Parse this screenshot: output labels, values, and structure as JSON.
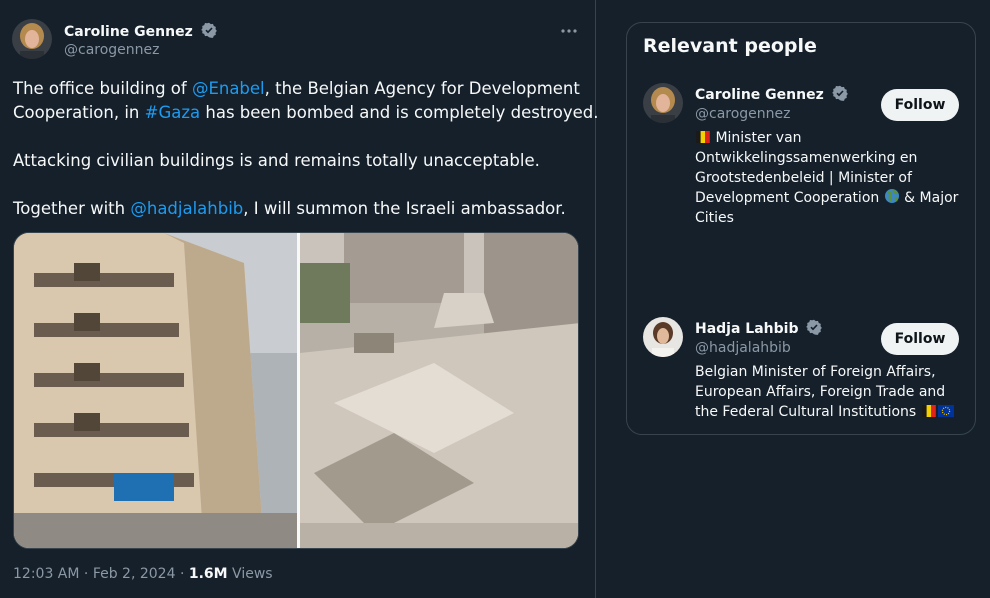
{
  "tweet": {
    "author_name": "Caroline Gennez",
    "author_handle": "@carogennez",
    "more_label": "···",
    "paragraph1": {
      "t1": "The office building of ",
      "mention1": "@Enabel",
      "t2": ", the Belgian Agency for Development",
      "t3": "Cooperation, in ",
      "hashtag": "#Gaza",
      "t4": " has been bombed and is completely destroyed."
    },
    "paragraph2": "Attacking civilian buildings is and remains totally unacceptable.",
    "paragraph3": {
      "t1": "Together with ",
      "mention": "@hadjalahbib",
      "t2": ", I will summon the Israeli ambassador."
    },
    "time": "12:03 AM",
    "separator": " · ",
    "date": "Feb 2, 2024",
    "views_count": "1.6M",
    "views_label": " Views"
  },
  "relevant_people": {
    "title": "Relevant people",
    "people": [
      {
        "name": "Caroline Gennez",
        "handle": "@carogennez",
        "follow_label": "Follow",
        "bio_line1": " Minister van",
        "bio_line2": "Ontwikkelingssamenwerking en",
        "bio_line3": "Grootstedenbeleid | Minister of",
        "bio_line4a": "Development Cooperation ",
        "bio_line4b": " & Major",
        "bio_line5": "Cities"
      },
      {
        "name": "Hadja Lahbib",
        "handle": "@hadjalahbib",
        "follow_label": "Follow",
        "bio_line1": "Belgian Minister of Foreign Affairs,",
        "bio_line2": "European Affairs, Foreign Trade and",
        "bio_line3": "the Federal Cultural Institutions "
      }
    ]
  },
  "colors": {
    "background": "#15202b",
    "link": "#1d9bf0",
    "verified": "#8b98a5",
    "border": "#38444d"
  },
  "icons": [
    "verified-badge-icon",
    "more-icon",
    "belgium-flag-icon",
    "globe-icon",
    "eu-flag-icon"
  ]
}
